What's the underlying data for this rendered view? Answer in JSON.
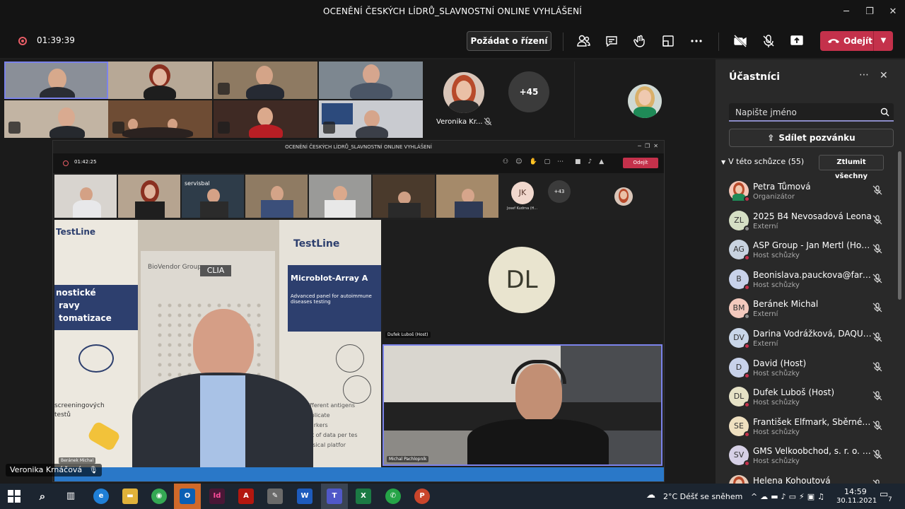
{
  "window": {
    "title": "OCENĚNÍ ČESKÝCH LÍDRŮ_SLAVNOSTNÍ ONLINE VYHLÁŠENÍ"
  },
  "toolbar": {
    "timer": "01:39:39",
    "request_control": "Požádat o řízení",
    "leave": "Odejít"
  },
  "gallery": {
    "overflow_name": "Veronika Kr...",
    "more_count": "+45"
  },
  "shared_screen": {
    "title": "OCENĚNÍ ČESKÝCH LÍDRŮ_SLAVNOSTNÍ ONLINE VYHLÁŠENÍ",
    "timer": "01:42:25",
    "leave": "Odejít",
    "jk_initials": "JK",
    "jk_name": "Josef Kudrna (H...",
    "more_count": "+43",
    "dl_initials": "DL",
    "dl_label": "Dufek Luboš (Host)",
    "main_label": "Beránek Michal",
    "second_label": "Michal Pachlopník",
    "poster": {
      "brand1": "TestLine",
      "brand2": "TestLine",
      "line1": "nostické",
      "line2": "ravy",
      "line3": "tomatizace",
      "biovendor": "BioVendor Group",
      "clia": "CLIA",
      "microblot": "Microblot-Array A",
      "microblot_sub": "Advanced panel for autoimmune diseases testing",
      "bottom1": "screeningových",
      "bottom2": "testů",
      "right1": "different antigens",
      "right2": "triplicate",
      "right3": "markers",
      "right4": "out of data per tes",
      "right5": "lassical platfor"
    }
  },
  "active_speaker_tag": "Veronika Krnáčová",
  "panel": {
    "title": "Účastníci",
    "search_placeholder": "Napište jméno",
    "invite": "Sdílet pozvánku",
    "section": "V této schůzce (55)",
    "mute_all": "Ztlumit všechny",
    "participants": [
      {
        "initials": "",
        "name": "Petra Tůmová",
        "role": "Organizátor",
        "color": "#f4c7b8",
        "status": "#c4314b",
        "photo": true
      },
      {
        "initials": "ZL",
        "name": "2025 B4 Nevosadová Leona",
        "role": "Externí",
        "color": "#d5dfc4",
        "status": "#8a8a8a"
      },
      {
        "initials": "AG",
        "name": "ASP Group - Jan Mertl (Host)",
        "role": "Host schůzky",
        "color": "#c8d3e0",
        "status": "#c4314b"
      },
      {
        "initials": "B",
        "name": "Beonislava.pauckova@farmak...",
        "role": "Host schůzky",
        "color": "#c8d2ea",
        "status": "#c4314b"
      },
      {
        "initials": "BM",
        "name": "Beránek Michal",
        "role": "Externí",
        "color": "#f3c9bd",
        "status": "#8a8a8a"
      },
      {
        "initials": "DV",
        "name": "Darina Vodrážková, DAQUAS",
        "role": "Externí",
        "color": "#c9d6e8",
        "status": "#c4314b"
      },
      {
        "initials": "D",
        "name": "David (Host)",
        "role": "Host schůzky",
        "color": "#c8d2ea",
        "status": "#c4314b"
      },
      {
        "initials": "DL",
        "name": "Dufek Luboš (Host)",
        "role": "Host schůzky",
        "color": "#e6e2c6",
        "status": "#c4314b"
      },
      {
        "initials": "SE",
        "name": "František Elfmark, Sběrné sur...",
        "role": "Host schůzky",
        "color": "#efe0c0",
        "status": "#c4314b"
      },
      {
        "initials": "SV",
        "name": "GMS Velkoobchod, s. r. o. (Ho...",
        "role": "Host schůzky",
        "color": "#d6d0e6",
        "status": "#c4314b"
      },
      {
        "initials": "",
        "name": "Helena Kohoutová",
        "role": "",
        "color": "#e8cbb8",
        "status": "#c4314b",
        "photo": true
      }
    ]
  },
  "taskbar": {
    "weather": "2°C  Déšť se sněhem",
    "time": "14:59",
    "date": "30.11.2021",
    "notifications": "7"
  }
}
